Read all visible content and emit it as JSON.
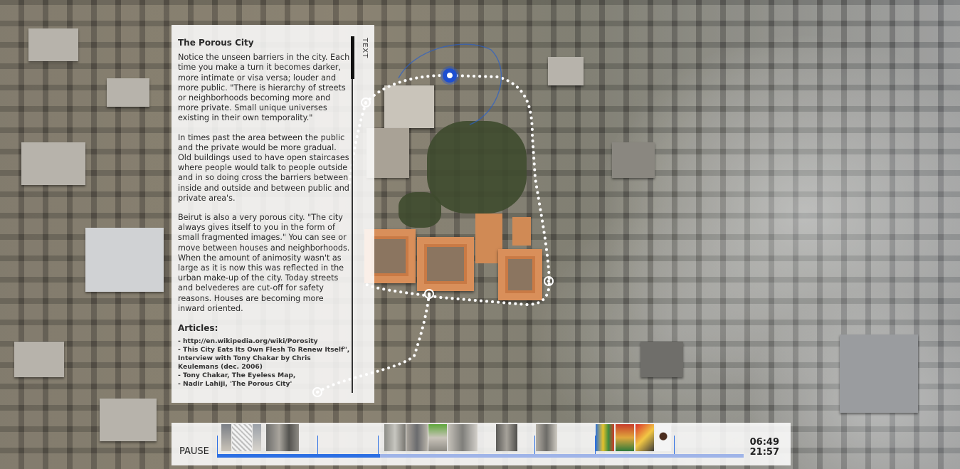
{
  "panel": {
    "title": "The Porous City",
    "tab_label": "TEXT",
    "paragraphs": [
      "Notice the unseen barriers in the city. Each time you make a turn it becomes darker, more intimate or visa versa; louder and more public. \"There is hierarchy of streets or neighborhoods becoming more and more private. Small unique universes existing in their own temporality.\"",
      "In times past the area between the public and the private would be more gradual. Old buildings used to have open staircases where people would talk to people outside and in so doing cross the barriers between inside and outside and between public and private area's.",
      "Beirut is also a very porous city. \"The city always gives itself to you in the form of small fragmented images.\" You can see or move between houses and neighborhoods. When the amount of animosity wasn't as large as it is now this was reflected in the urban make-up of the city. Today streets and belvederes are cut-off for safety reasons. Houses are becoming more inward oriented."
    ],
    "articles_title": "Articles:",
    "articles": [
      "- http://en.wikipedia.org/wiki/Porosity",
      "- This City Eats Its Own Flesh To Renew Itself\", Interview with Tony Chakar by Chris Keulemans (dec. 2006)",
      "- Tony Chakar, The Eyeless Map,",
      "- Nadir Lahiji, 'The Porous City'"
    ]
  },
  "player": {
    "pause_label": "PAUSE",
    "current_time": "06:49",
    "total_time": "21:57",
    "progress": 0.31,
    "colors": {
      "played": "#2c6fe3",
      "track": "#9fb4e8"
    }
  },
  "map": {
    "route_color": "#ffffff",
    "current_marker_color": "#1e4fd0"
  }
}
